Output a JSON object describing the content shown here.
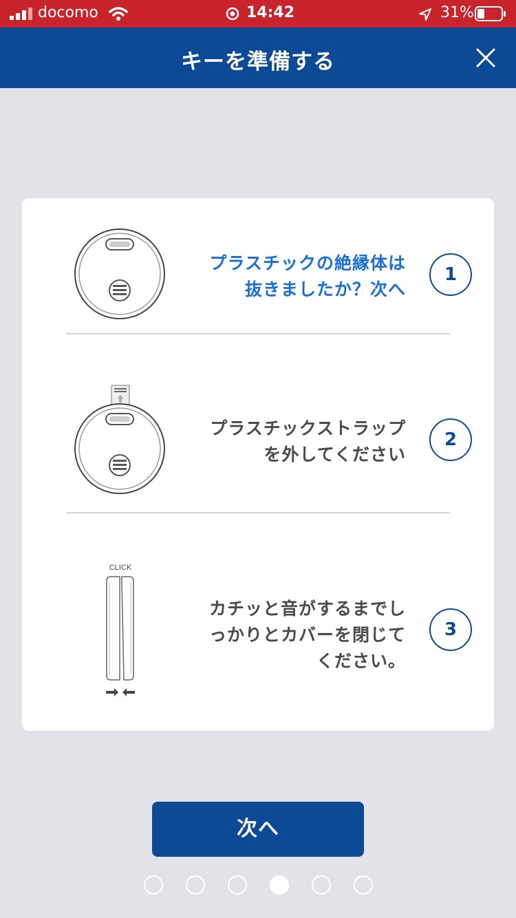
{
  "status_bar": {
    "carrier": "docomo",
    "time": "14:42",
    "battery": "31%"
  },
  "header": {
    "title": "キーを準備する"
  },
  "steps": [
    {
      "number": "1",
      "text_line1": "プラスチックの絶縁体は",
      "text_line2": "抜きましたか？次へ"
    },
    {
      "number": "2",
      "text_line1": "プラスチックストラップ",
      "text_line2": "を外してください"
    },
    {
      "number": "3",
      "text_line1": "カチッと音がするまでし",
      "text_line2": "っかりとカバーを閉じて",
      "text_line3": "ください。",
      "illustration_label": "CLICK"
    }
  ],
  "next_button": {
    "label": "次へ"
  },
  "pagination": {
    "total": 6,
    "current": 4
  },
  "colors": {
    "status_bar": "#c9242b",
    "header": "#0c4a95",
    "accent_text": "#1a6fd4",
    "background": "#e2e3e8"
  }
}
